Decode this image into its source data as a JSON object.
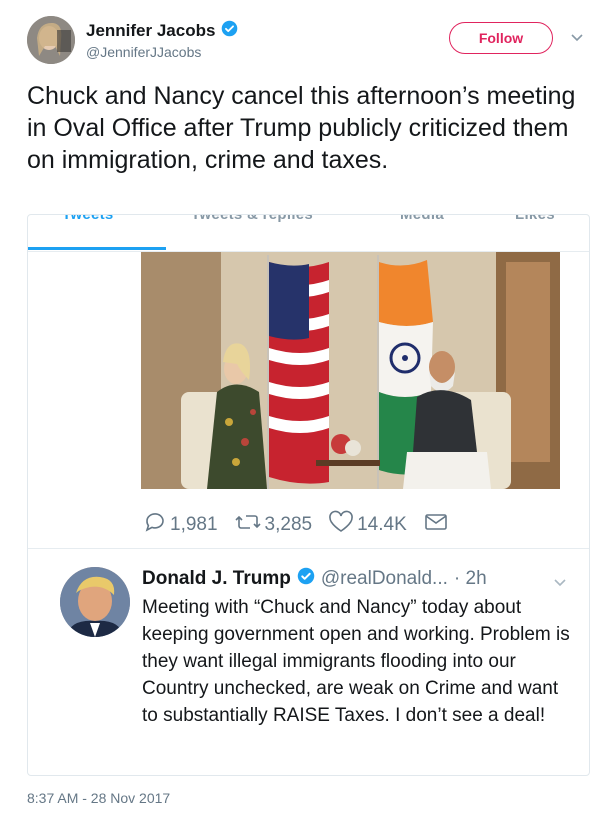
{
  "author": {
    "name": "Jennifer Jacobs",
    "handle": "@JenniferJJacobs",
    "verified": true
  },
  "follow_label": "Follow",
  "tweet_text": "Chuck and Nancy cancel this afternoon’s meeting in Oval Office after Trump publicly criticized them on immigration, crime and taxes.",
  "embedded": {
    "tabs": [
      "Tweets",
      "Tweets & replies",
      "Media",
      "Likes"
    ],
    "active_tab": "Tweets",
    "stats": {
      "replies": "1,981",
      "retweets": "3,285",
      "likes": "14.4K"
    },
    "quoted_tweet": {
      "name": "Donald J. Trump",
      "handle": "@realDonald...",
      "time": "· 2h",
      "verified": true,
      "text": "Meeting with “Chuck and Nancy” today about keeping government open and working. Problem is they want illegal immigrants flooding into our Country unchecked, are weak on Crime and want to substantially RAISE Taxes. I don’t see a deal!"
    }
  },
  "timestamp": "8:37 AM - 28 Nov 2017",
  "colors": {
    "accent": "#1da1f2",
    "follow": "#e0245e",
    "muted": "#657786"
  }
}
